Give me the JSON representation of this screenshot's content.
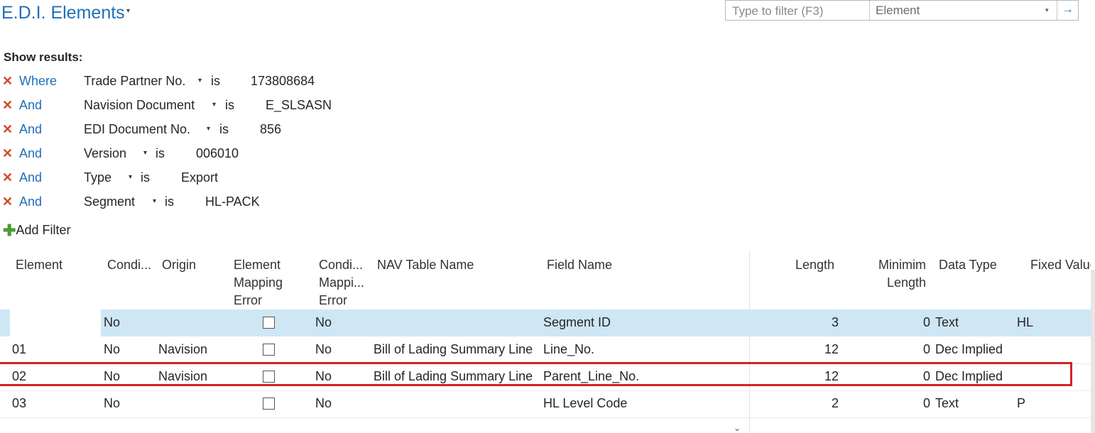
{
  "header": {
    "title": "E.D.I. Elements",
    "title_caret": "▾",
    "filter_placeholder": "Type to filter (F3)",
    "filter_field": "Element",
    "filter_caret": "▾",
    "go_icon": "→"
  },
  "filters": {
    "label": "Show results:",
    "remove_icon": "✕",
    "rows": [
      {
        "conj": "Where",
        "field": "Trade Partner No.",
        "op": "is",
        "value": "173808684"
      },
      {
        "conj": "And",
        "field": "Navision Document",
        "op": "is",
        "value": "E_SLSASN"
      },
      {
        "conj": "And",
        "field": "EDI Document No.",
        "op": "is",
        "value": "856"
      },
      {
        "conj": "And",
        "field": "Version",
        "op": "is",
        "value": "006010"
      },
      {
        "conj": "And",
        "field": "Type",
        "op": "is",
        "value": "Export"
      },
      {
        "conj": "And",
        "field": "Segment",
        "op": "is",
        "value": "HL-PACK"
      }
    ],
    "caret": "▾",
    "add_icon": "✚",
    "add_label": "Add Filter"
  },
  "table": {
    "columns": {
      "element": "Element",
      "condition": "Condi...",
      "origin": "Origin",
      "mapping_error_1": "Element",
      "mapping_error_2": "Mapping",
      "mapping_error_3": "Error",
      "cond_mapping_1": "Condi...",
      "cond_mapping_2": "Mappi...",
      "cond_mapping_3": "Error",
      "nav_table": "NAV Table Name",
      "field_name": "Field Name",
      "length": "Length",
      "min_length_1": "Minimim",
      "min_length_2": "Length",
      "data_type": "Data Type",
      "fixed_value": "Fixed Value"
    },
    "rows": [
      {
        "element": "",
        "condition": "No",
        "origin": "",
        "mapping_error": false,
        "cond_mapping": "No",
        "nav_table": "",
        "field_name": "Segment ID",
        "length": "3",
        "min_length": "0",
        "data_type": "Text",
        "fixed_value": "HL"
      },
      {
        "element": "01",
        "condition": "No",
        "origin": "Navision",
        "mapping_error": false,
        "cond_mapping": "No",
        "nav_table": "Bill of Lading Summary Line",
        "field_name": "Line_No.",
        "length": "12",
        "min_length": "0",
        "data_type": "Dec Implied",
        "fixed_value": ""
      },
      {
        "element": "02",
        "condition": "No",
        "origin": "Navision",
        "mapping_error": false,
        "cond_mapping": "No",
        "nav_table": "Bill of Lading Summary Line",
        "field_name": "Parent_Line_No.",
        "length": "12",
        "min_length": "0",
        "data_type": "Dec Implied",
        "fixed_value": ""
      },
      {
        "element": "03",
        "condition": "No",
        "origin": "",
        "mapping_error": false,
        "cond_mapping": "No",
        "nav_table": "",
        "field_name": "HL Level Code",
        "length": "2",
        "min_length": "0",
        "data_type": "Text",
        "fixed_value": "P"
      }
    ],
    "more_icon": "⌄"
  },
  "colors": {
    "accent": "#1f6eb8",
    "remove": "#d4462b",
    "add": "#4a9a3a",
    "selected_row": "#cfe6f5",
    "highlight_box": "#d42027"
  }
}
